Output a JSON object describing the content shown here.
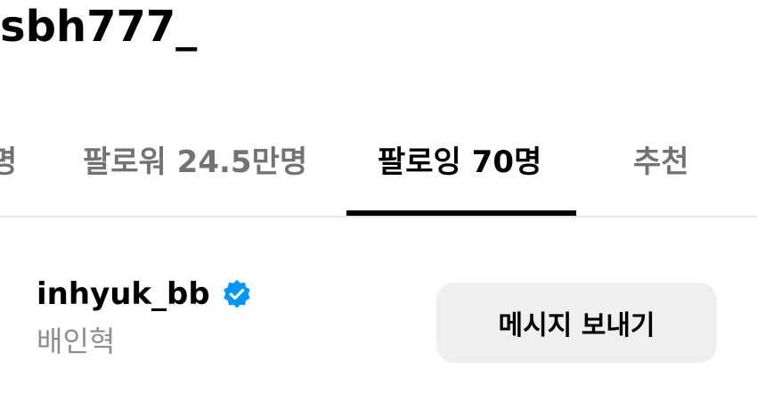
{
  "profile": {
    "username": "sbh777_"
  },
  "tabs": [
    {
      "label": "명",
      "active": false
    },
    {
      "label": "팔로워 24.5만명",
      "active": false
    },
    {
      "label": "팔로잉 70명",
      "active": true
    },
    {
      "label": "추천",
      "active": false
    }
  ],
  "following_list": [
    {
      "handle": "inhyuk_bb",
      "full_name": "배인혁",
      "verified": true,
      "verified_icon": "verified-badge-icon",
      "button_label": "메시지 보내기"
    }
  ],
  "colors": {
    "verified_blue": "#0095f6",
    "inactive_tab": "#737373",
    "secondary_text": "#8e8e8e",
    "button_bg": "#efeff2"
  }
}
